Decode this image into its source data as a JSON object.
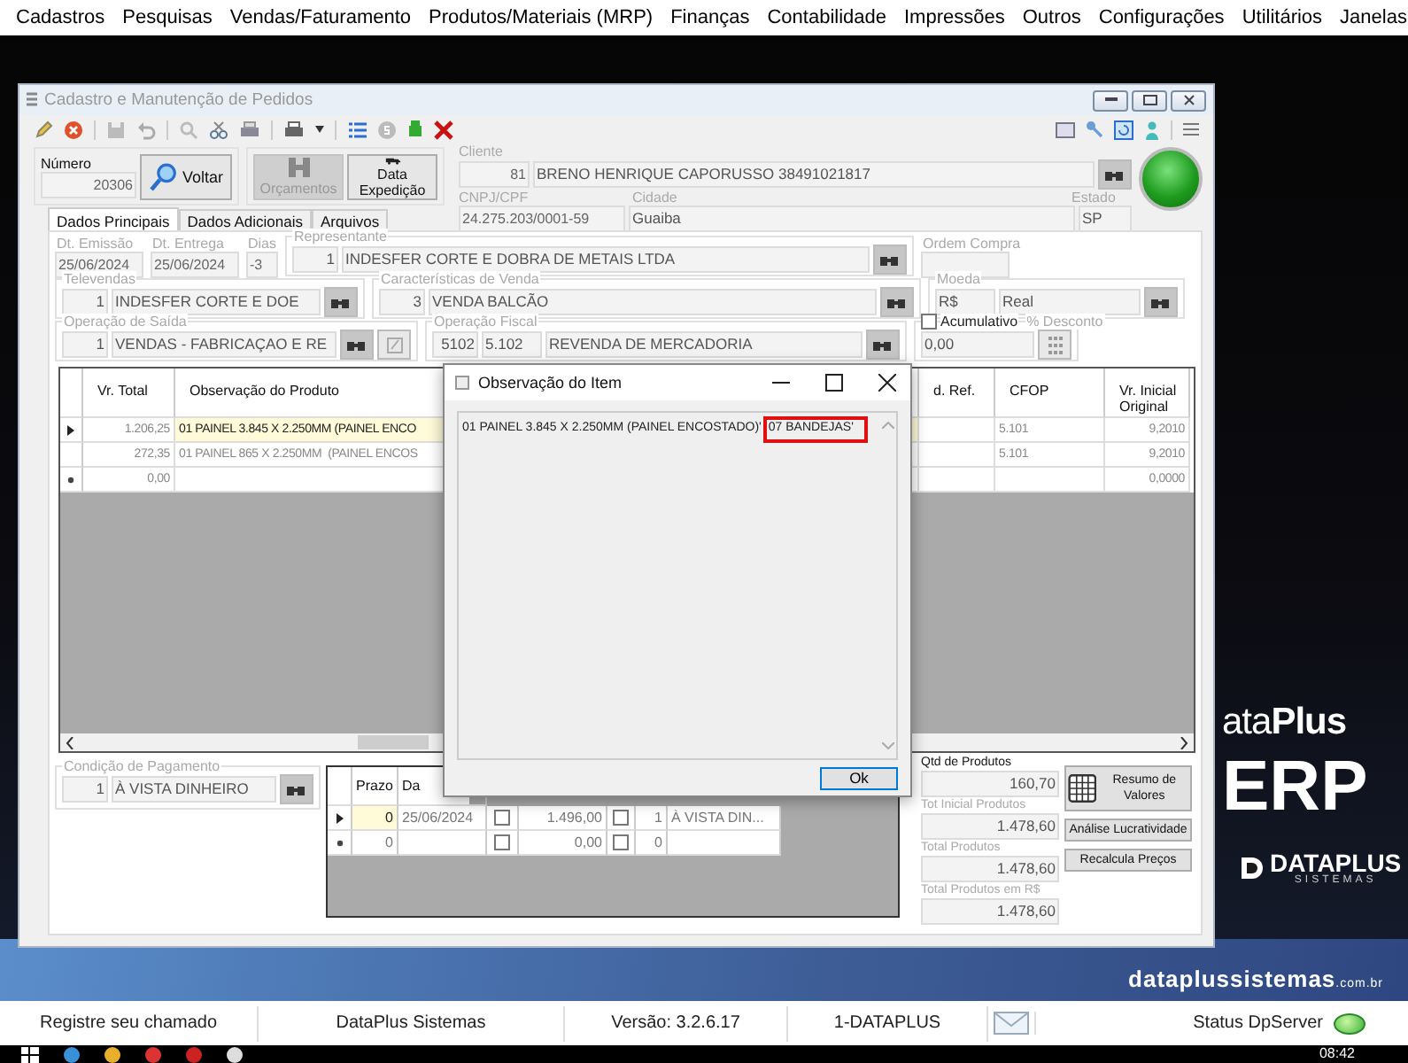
{
  "menu": [
    "Cadastros",
    "Pesquisas",
    "Vendas/Faturamento",
    "Produtos/Materiais (MRP)",
    "Finanças",
    "Contabilidade",
    "Impressões",
    "Outros",
    "Configurações",
    "Utilitários",
    "Janelas"
  ],
  "brand": {
    "wordmark": "ata",
    "wordmark_bold": "Plus",
    "product": "ERP",
    "company": "DATAPLUS",
    "company_tagline": "SISTEMAS",
    "site": "dataplussistemas",
    "site_suffix": ".com.br"
  },
  "window": {
    "title": "Cadastro e Manutenção de Pedidos"
  },
  "numero": {
    "label": "Número",
    "value": "20306"
  },
  "actions": [
    {
      "label": "Voltar",
      "kind": "search",
      "disabled": false
    },
    {
      "label": "Orçamentos",
      "kind": "binder",
      "disabled": true
    },
    {
      "label": "Data Expedição",
      "kind": "truck",
      "disabled": false
    }
  ],
  "cliente": {
    "label": "Cliente",
    "code": "81",
    "name": "BRENO HENRIQUE CAPORUSSO 38491021817",
    "cnpj_label": "CNPJ/CPF",
    "cnpj": "24.275.203/0001-59",
    "cidade_label": "Cidade",
    "cidade": "Guaiba",
    "estado_label": "Estado",
    "estado": "SP"
  },
  "tabs": [
    {
      "label": "Dados Principais",
      "selected": true
    },
    {
      "label": "Dados Adicionais",
      "selected": false
    },
    {
      "label": "Arquivos",
      "selected": false
    }
  ],
  "field_rows": [
    [
      {
        "label": "Dt. Emissão",
        "framed": false,
        "cells": [
          {
            "kind": "value",
            "value": "25/06/2024"
          }
        ]
      },
      {
        "label": "Dt. Entrega",
        "framed": false,
        "cells": [
          {
            "kind": "value",
            "value": "25/06/2024"
          }
        ]
      },
      {
        "label": "Dias",
        "framed": false,
        "cells": [
          {
            "kind": "value",
            "value": "-3"
          }
        ]
      },
      {
        "label": "Representante",
        "framed": true,
        "cells": [
          {
            "kind": "code",
            "value": "1"
          },
          {
            "kind": "value",
            "value": "INDESFER CORTE E DOBRA DE METAIS LTDA"
          },
          {
            "kind": "lookup"
          }
        ]
      },
      {
        "label": "Ordem Compra",
        "framed": false,
        "cells": [
          {
            "kind": "blank"
          }
        ]
      }
    ],
    [
      {
        "label": "Televendas",
        "framed": true,
        "cells": [
          {
            "kind": "code",
            "value": "1"
          },
          {
            "kind": "value",
            "value": "INDESFER CORTE E DOE"
          },
          {
            "kind": "lookup"
          }
        ]
      },
      {
        "label": "Características de Venda",
        "framed": true,
        "cells": [
          {
            "kind": "code",
            "value": "3"
          },
          {
            "kind": "value",
            "value": "VENDA BALCÃO"
          },
          {
            "kind": "lookup"
          }
        ]
      },
      {
        "label": "Moeda",
        "framed": true,
        "cells": [
          {
            "kind": "short",
            "value": "R$"
          },
          {
            "kind": "value",
            "value": "Real"
          },
          {
            "kind": "lookup"
          }
        ]
      }
    ],
    [
      {
        "label": "Operação de Saída",
        "framed": true,
        "cells": [
          {
            "kind": "code",
            "value": "1"
          },
          {
            "kind": "value",
            "value": "VENDAS - FABRICAÇAO E RE"
          },
          {
            "kind": "lookup"
          },
          {
            "kind": "edit"
          }
        ]
      },
      {
        "label": "Operação Fiscal",
        "framed": true,
        "cells": [
          {
            "kind": "code",
            "value": "5102"
          },
          {
            "kind": "short",
            "value": "5.102"
          },
          {
            "kind": "value",
            "value": "REVENDA DE MERCADORIA"
          },
          {
            "kind": "lookup"
          }
        ]
      },
      {
        "label": "% Desconto",
        "framed": true,
        "check": {
          "label": "Acumulativo",
          "checked": false
        },
        "cells": [
          {
            "kind": "value",
            "value": "0,00"
          },
          {
            "kind": "calc"
          }
        ]
      }
    ]
  ],
  "items_table": {
    "columns": [
      "Vr. Total",
      "Observação do Produto",
      "d. Ref.",
      "CFOP",
      "Vr. Inicial Original"
    ],
    "rows": [
      {
        "kind": "current",
        "selected": true,
        "vr_total": "1.206,25",
        "observacao": "01 PAINEL 3.845 X 2.250MM (PAINEL ENCO",
        "cfop": "5.101",
        "vr_inicial": "9,2010"
      },
      {
        "kind": "data",
        "selected": false,
        "vr_total": "272,35",
        "observacao": "01 PAINEL 865 X 2.250MM  (PAINEL ENCOS",
        "cfop": "5.101",
        "vr_inicial": "9,2010"
      },
      {
        "kind": "new",
        "selected": false,
        "vr_total": "0,00",
        "vr_inicial": "0,0000"
      }
    ]
  },
  "pagamento": {
    "label": "Condição de Pagamento",
    "code": "1",
    "name": "À VISTA DINHEIRO"
  },
  "parcelas": {
    "columns": [
      "Prazo",
      "Da"
    ],
    "rows": [
      {
        "kind": "current",
        "selected": true,
        "prazo": "0",
        "data": "25/06/2024",
        "check_a": false,
        "valor": "1.496,00",
        "check_b": false,
        "numero": "1",
        "forma": "À VISTA DIN..."
      },
      {
        "kind": "new",
        "selected": false,
        "prazo": "0",
        "check_a": false,
        "valor": "0,00",
        "check_b": false,
        "numero": "0"
      }
    ]
  },
  "totals": [
    {
      "label": "Qtd de Produtos",
      "value": "160,70",
      "disabled": false
    },
    {
      "label": "Tot Inicial Produtos",
      "value": "1.478,60",
      "disabled": true
    },
    {
      "label": "Total Produtos",
      "value": "1.478,60",
      "disabled": true
    },
    {
      "label": "Total Produtos em R$",
      "value": "1.478,60",
      "disabled": true
    }
  ],
  "side_buttons": [
    {
      "label": "Resumo de Valores",
      "kind": "icon"
    },
    {
      "label": "Análise Lucratividade",
      "kind": "plain"
    },
    {
      "label": "Recalcula Preços",
      "kind": "plain"
    }
  ],
  "dialog": {
    "title": "Observação do Item",
    "text": "01 PAINEL 3.845 X 2.250MM (PAINEL ENCOSTADO)'",
    "marked": "07 BANDEJAS'",
    "button": "Ok"
  },
  "status_bar": [
    {
      "kind": "text",
      "text": "Registre seu chamado"
    },
    {
      "kind": "text",
      "text": "DataPlus Sistemas"
    },
    {
      "kind": "text",
      "text": "Versão: 3.2.6.17"
    },
    {
      "kind": "text",
      "text": "1-DATAPLUS"
    },
    {
      "kind": "mail"
    },
    {
      "kind": "status",
      "text": "Status DpServer"
    }
  ],
  "clock": "08:42"
}
